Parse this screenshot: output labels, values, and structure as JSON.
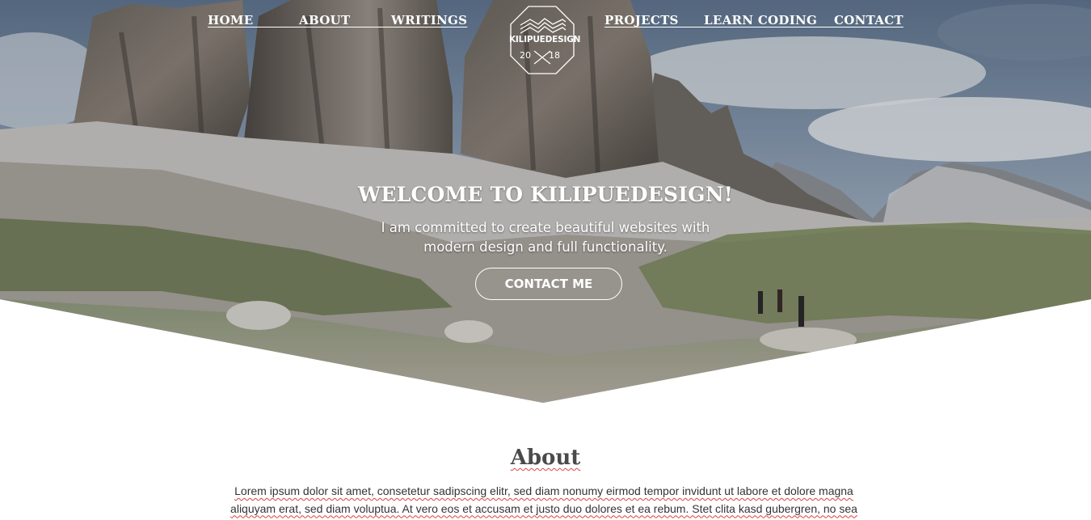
{
  "nav": {
    "left": [
      "HOME",
      "ABOUT",
      "WRITINGS"
    ],
    "right": [
      "PROJECTS",
      "LEARN CODING",
      "CONTACT"
    ]
  },
  "logo": {
    "name": "KILIPUEDESIGN",
    "year_left": "20",
    "year_right": "18"
  },
  "hero": {
    "title": "WELCOME TO KILIPUEDESIGN!",
    "subtitle_line1": "I am committed to create beautiful websites with",
    "subtitle_line2": "modern design and full functionality.",
    "cta_label": "CONTACT ME"
  },
  "about": {
    "title": "About",
    "line1": "Lorem ipsum dolor sit amet, consetetur sadipscing elitr, sed diam nonumy eirmod tempor invidunt ut labore et dolore magna",
    "line2": "aliquyam erat, sed diam voluptua. At vero eos et accusam et justo duo dolores et ea rebum. Stet clita kasd gubergren, no sea"
  },
  "colors": {
    "text_light": "#ffffff",
    "heading_dark": "#4a4a4a",
    "spellcheck_underline": "#e03c3c"
  },
  "icons": {
    "logo": "mountain-wave-octagon-icon"
  }
}
